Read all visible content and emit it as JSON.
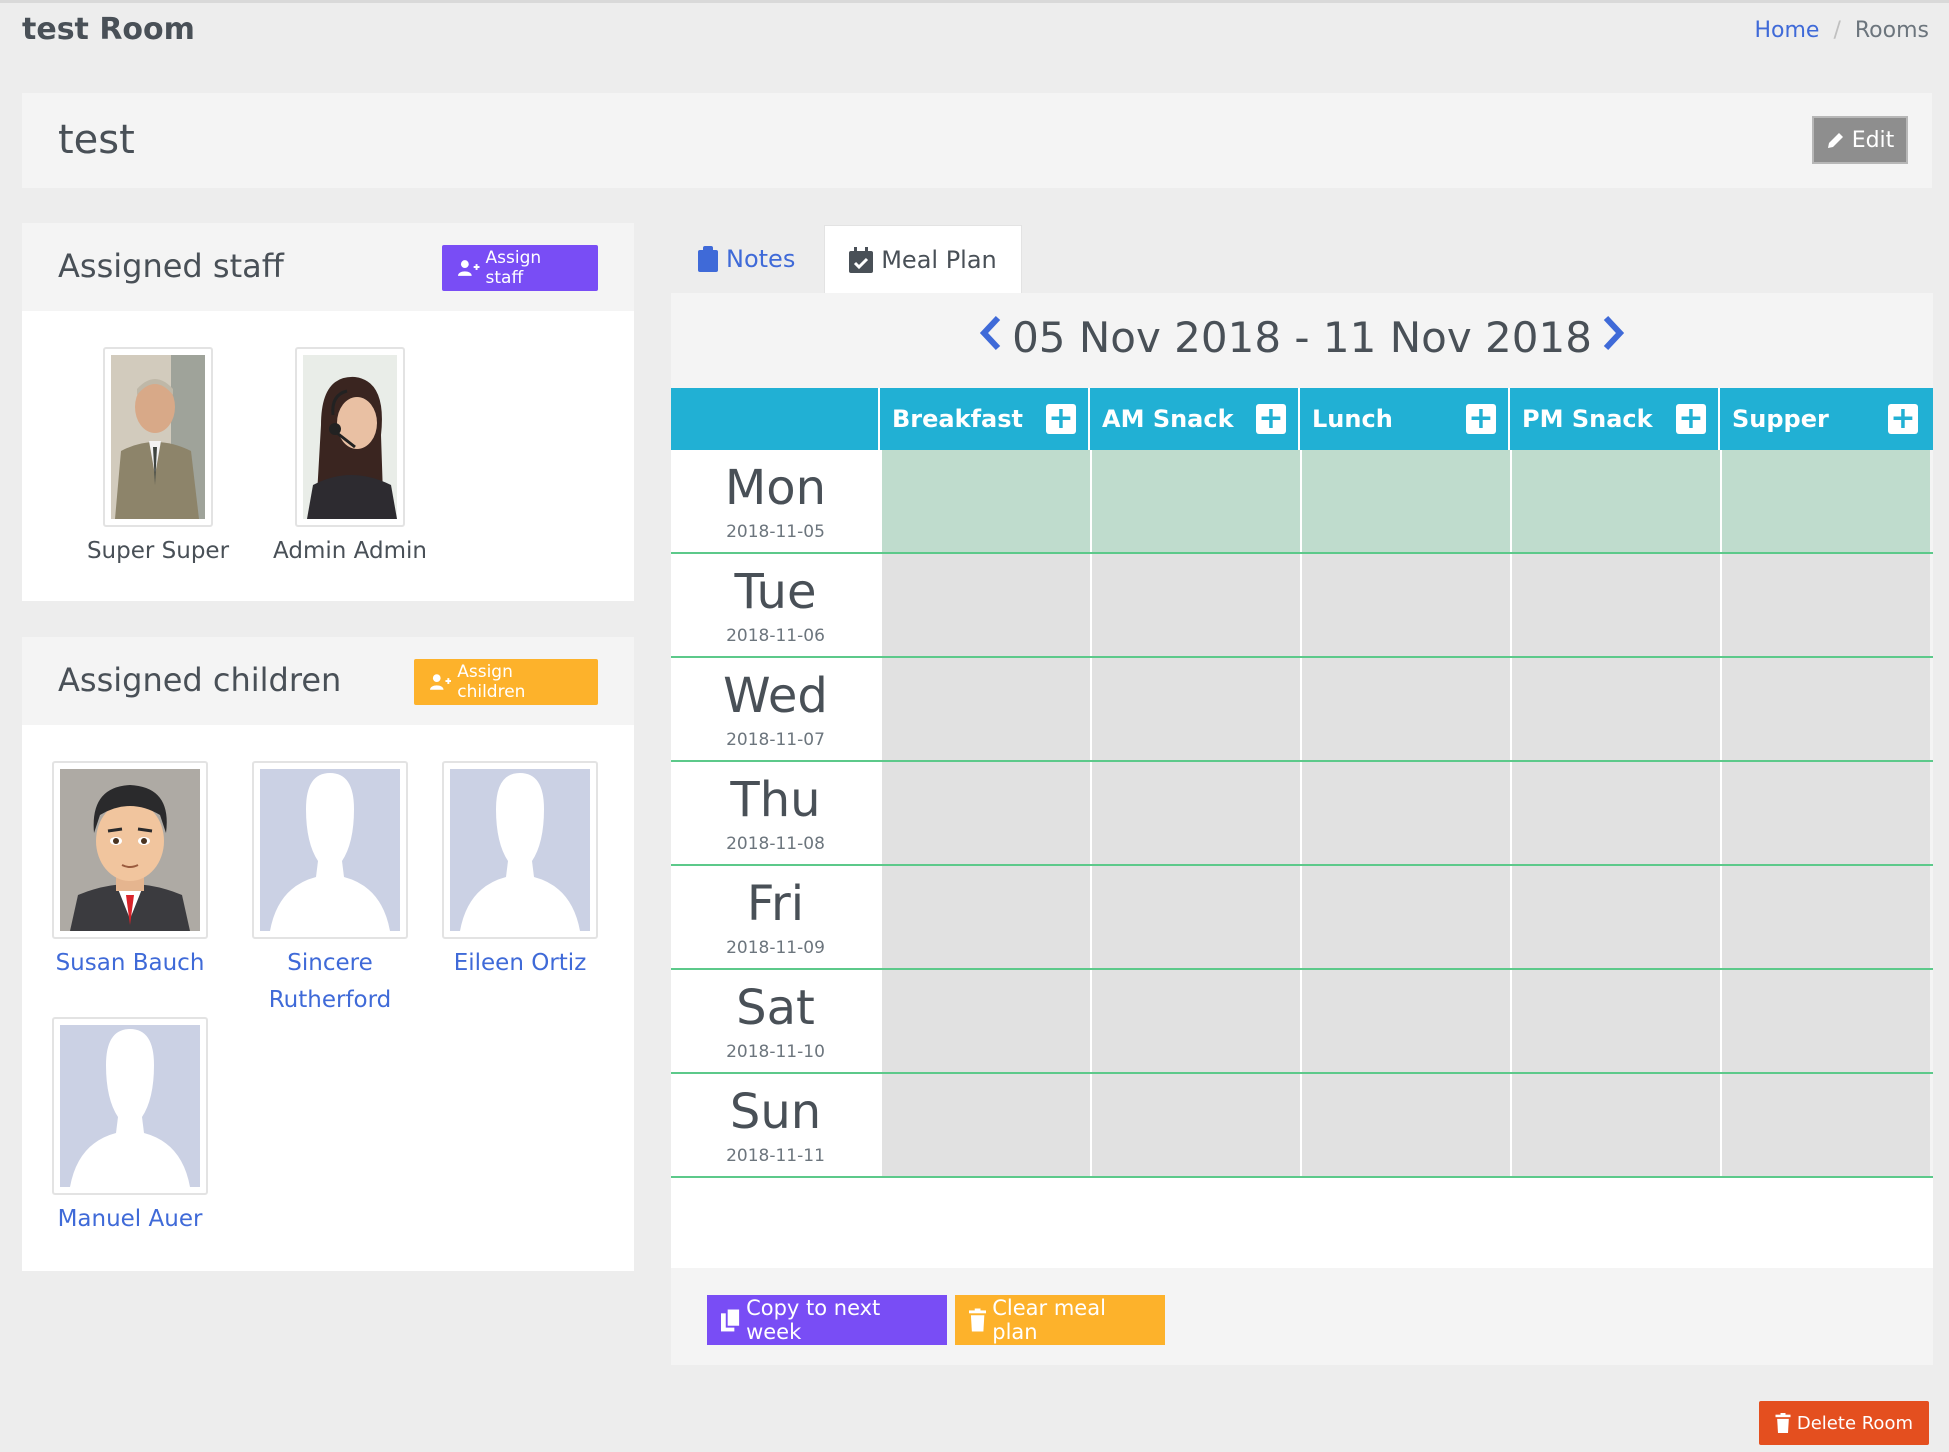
{
  "header": {
    "title": "test Room"
  },
  "breadcrumb": {
    "home": "Home",
    "separator": "/",
    "current": "Rooms"
  },
  "room": {
    "name": "test",
    "edit_label": "Edit"
  },
  "staff": {
    "title": "Assigned staff",
    "button_label": "Assign staff",
    "members": [
      {
        "name": "Super Super",
        "avatar": "man-in-suit-photo"
      },
      {
        "name": "Admin Admin",
        "avatar": "woman-with-headset-photo"
      }
    ]
  },
  "children": {
    "title": "Assigned children",
    "button_label": "Assign children",
    "members": [
      {
        "name": "Susan Bauch",
        "avatar": "cartoon-man-avatar"
      },
      {
        "name": "Sincere Rutherford",
        "avatar": "silhouette-placeholder"
      },
      {
        "name": "Eileen Ortiz",
        "avatar": "silhouette-placeholder"
      },
      {
        "name": "Manuel Auer",
        "avatar": "silhouette-placeholder"
      }
    ]
  },
  "tabs": [
    {
      "label": "Notes",
      "icon": "clipboard-icon",
      "active": false
    },
    {
      "label": "Meal Plan",
      "icon": "calendar-check-icon",
      "active": true
    }
  ],
  "meal_plan": {
    "week_range": "05 Nov 2018 - 11 Nov 2018",
    "meals": [
      "Breakfast",
      "AM Snack",
      "Lunch",
      "PM Snack",
      "Supper"
    ],
    "days": [
      {
        "name": "Mon",
        "date": "2018-11-05",
        "current": true
      },
      {
        "name": "Tue",
        "date": "2018-11-06",
        "current": false
      },
      {
        "name": "Wed",
        "date": "2018-11-07",
        "current": false
      },
      {
        "name": "Thu",
        "date": "2018-11-08",
        "current": false
      },
      {
        "name": "Fri",
        "date": "2018-11-09",
        "current": false
      },
      {
        "name": "Sat",
        "date": "2018-11-10",
        "current": false
      },
      {
        "name": "Sun",
        "date": "2018-11-11",
        "current": false
      }
    ],
    "copy_label": "Copy to next week",
    "clear_label": "Clear meal plan"
  },
  "delete_label": "Delete Room",
  "colors": {
    "accent_blue": "#3f6ad8",
    "purple": "#794df5",
    "yellow": "#fdb22b",
    "teal_header": "#21b0d4",
    "current_day": "#bfdccd",
    "row_divider": "#5cc98a",
    "danger": "#e44f1f"
  }
}
